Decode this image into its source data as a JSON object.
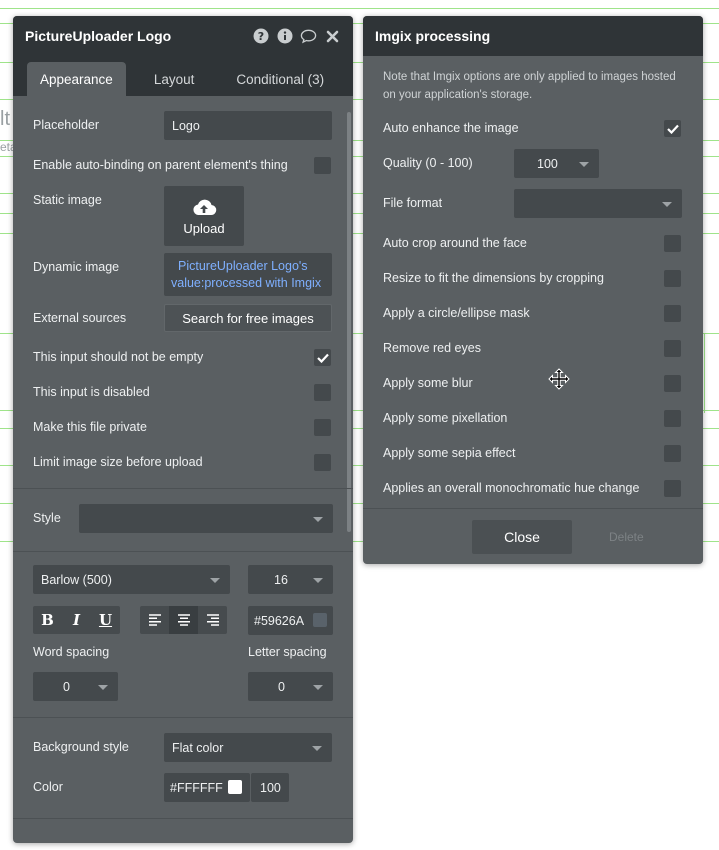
{
  "background": {
    "fragment_1": "lt",
    "fragment_2": "eta"
  },
  "uploader_panel": {
    "title": "PictureUploader Logo",
    "icons": [
      "help-icon",
      "info-icon",
      "comment-icon",
      "close-icon"
    ],
    "tabs": [
      {
        "label": "Appearance",
        "active": true
      },
      {
        "label": "Layout",
        "active": false
      },
      {
        "label": "Conditional (3)",
        "active": false
      }
    ],
    "placeholder": {
      "label": "Placeholder",
      "value": "Logo"
    },
    "auto_binding": {
      "label": "Enable auto-binding on parent element's thing",
      "checked": false
    },
    "static_image": {
      "label": "Static image",
      "button": "Upload"
    },
    "dynamic_image": {
      "label": "Dynamic image",
      "line1": "PictureUploader Logo's",
      "line2": "value:processed with Imgix"
    },
    "external_sources": {
      "label": "External sources",
      "button": "Search for free images"
    },
    "not_empty": {
      "label": "This input should not be empty",
      "checked": true
    },
    "disabled": {
      "label": "This input is disabled",
      "checked": false
    },
    "private": {
      "label": "Make this file private",
      "checked": false
    },
    "limit_size": {
      "label": "Limit image size before upload",
      "checked": false
    },
    "style": {
      "label": "Style",
      "value": ""
    },
    "font": {
      "family": "Barlow (500)",
      "size": "16",
      "color": "#59626A"
    },
    "format": {
      "bold": "B",
      "italic": "I",
      "underline": "U",
      "align_selected": "center"
    },
    "word_spacing": {
      "label": "Word spacing",
      "value": "0"
    },
    "letter_spacing": {
      "label": "Letter spacing",
      "value": "0"
    },
    "background_style": {
      "label": "Background style",
      "value": "Flat color"
    },
    "color": {
      "label": "Color",
      "hex": "#FFFFFF",
      "opacity": "100"
    }
  },
  "imgix_panel": {
    "title": "Imgix processing",
    "note": "Note that Imgix options are only applied to images hosted on your application's storage.",
    "auto_enhance": {
      "label": "Auto enhance the image",
      "checked": true
    },
    "quality": {
      "label": "Quality (0 - 100)",
      "value": "100"
    },
    "file_format": {
      "label": "File format",
      "value": ""
    },
    "options": [
      {
        "label": "Auto crop around the face",
        "checked": false
      },
      {
        "label": "Resize to fit the dimensions by cropping",
        "checked": false
      },
      {
        "label": "Apply a circle/ellipse mask",
        "checked": false
      },
      {
        "label": "Remove red eyes",
        "checked": false
      },
      {
        "label": "Apply some blur",
        "checked": false
      },
      {
        "label": "Apply some pixellation",
        "checked": false
      },
      {
        "label": "Apply some sepia effect",
        "checked": false
      },
      {
        "label": "Applies an overall monochromatic hue change",
        "checked": false
      }
    ],
    "close_button": "Close",
    "delete_button": "Delete"
  },
  "colors": {
    "panel": "#5a5f62",
    "header": "#2f3437",
    "field": "#44494c",
    "link": "#7fb0ff",
    "guide": "#9fe48a"
  }
}
